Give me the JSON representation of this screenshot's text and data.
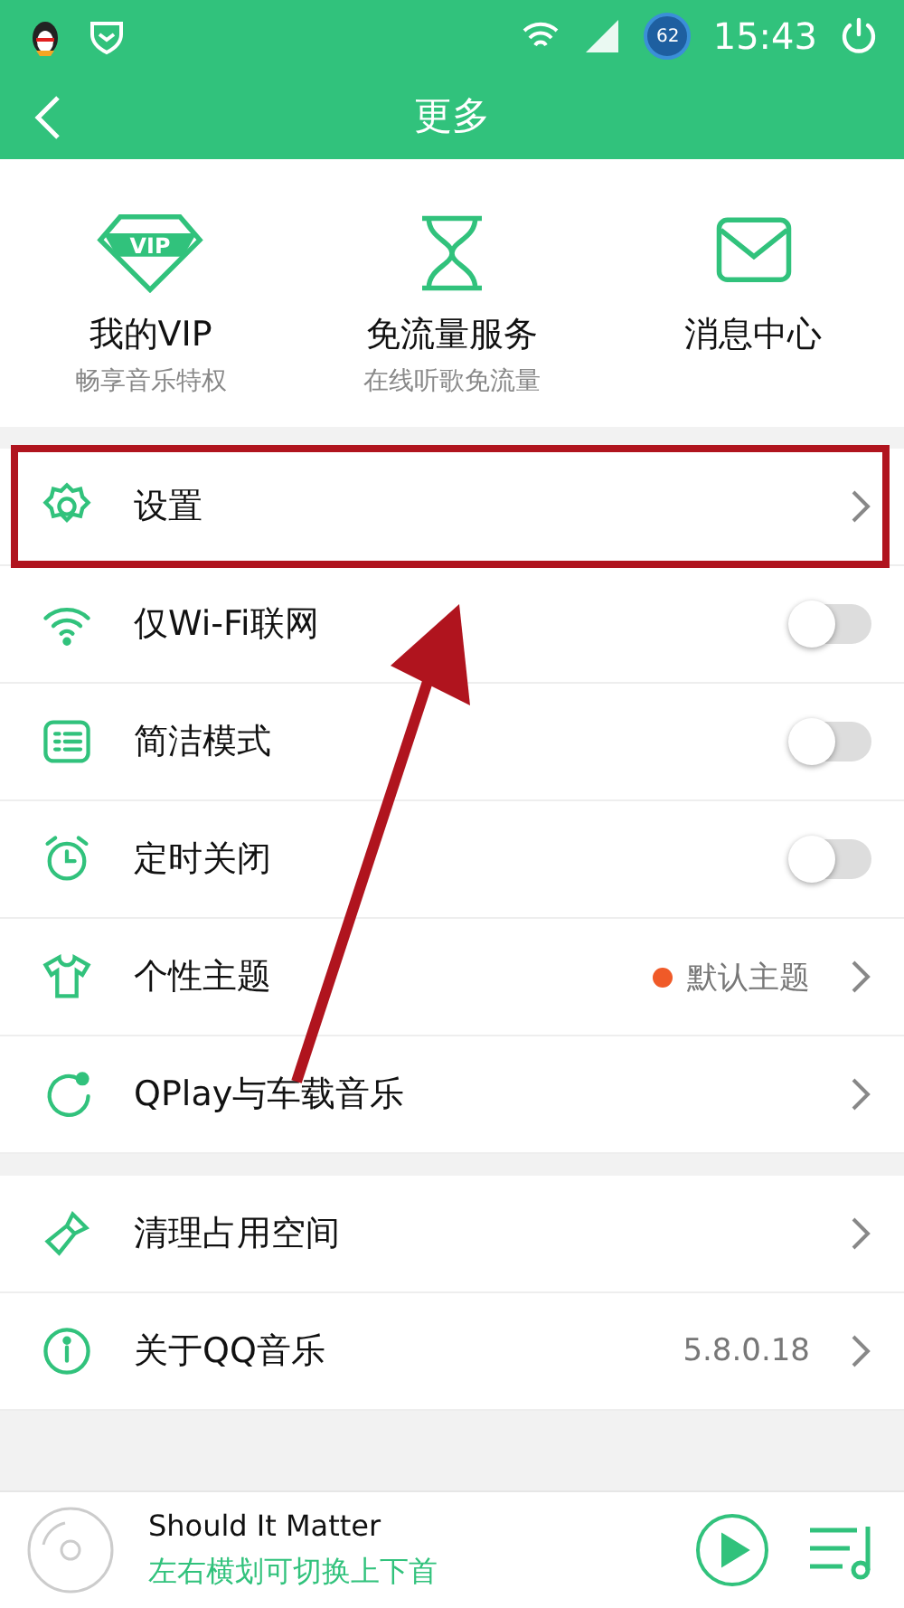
{
  "status_bar": {
    "battery": "62",
    "time": "15:43"
  },
  "header": {
    "title": "更多"
  },
  "shortcuts": [
    {
      "kind": "vip",
      "badge": "VIP",
      "title": "我的VIP",
      "subtitle": "畅享音乐特权"
    },
    {
      "kind": "hourglass",
      "title": "免流量服务",
      "subtitle": "在线听歌免流量"
    },
    {
      "kind": "mail",
      "title": "消息中心"
    }
  ],
  "groups": [
    [
      {
        "kind": "link",
        "label": "设置",
        "highlighted": true
      },
      {
        "kind": "toggle",
        "label": "仅Wi-Fi联网",
        "on": false
      },
      {
        "kind": "toggle",
        "label": "简洁模式",
        "on": false
      },
      {
        "kind": "toggle",
        "label": "定时关闭",
        "on": false
      },
      {
        "kind": "link",
        "label": "个性主题",
        "value": "默认主题",
        "color": "#f05a28"
      },
      {
        "kind": "link",
        "label": "QPlay与车载音乐"
      }
    ],
    [
      {
        "kind": "link",
        "label": "清理占用空间"
      },
      {
        "kind": "link",
        "label": "关于QQ音乐",
        "value": "5.8.0.18"
      }
    ]
  ],
  "player": {
    "song": "Should It Matter",
    "hint": "左右横划可切换上下首"
  }
}
